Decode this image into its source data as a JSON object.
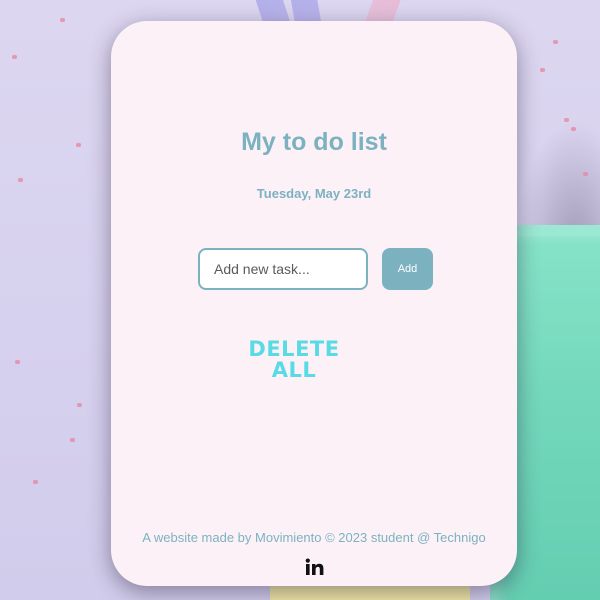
{
  "app": {
    "title": "My to do list",
    "date": "Tuesday, May 23rd"
  },
  "task_form": {
    "input_placeholder": "Add new task...",
    "input_value": "",
    "add_label": "Add"
  },
  "actions": {
    "delete_all_label": "DELETE ALL"
  },
  "footer": {
    "credit": "A website made by Movimiento © 2023 student @ Technigo",
    "social_icon": "linkedin-icon"
  },
  "colors": {
    "accent": "#7cb2c0",
    "delete_accent": "#59dbe6",
    "card_background": "#fdf1f8",
    "page_background": "#d8d3ee"
  }
}
